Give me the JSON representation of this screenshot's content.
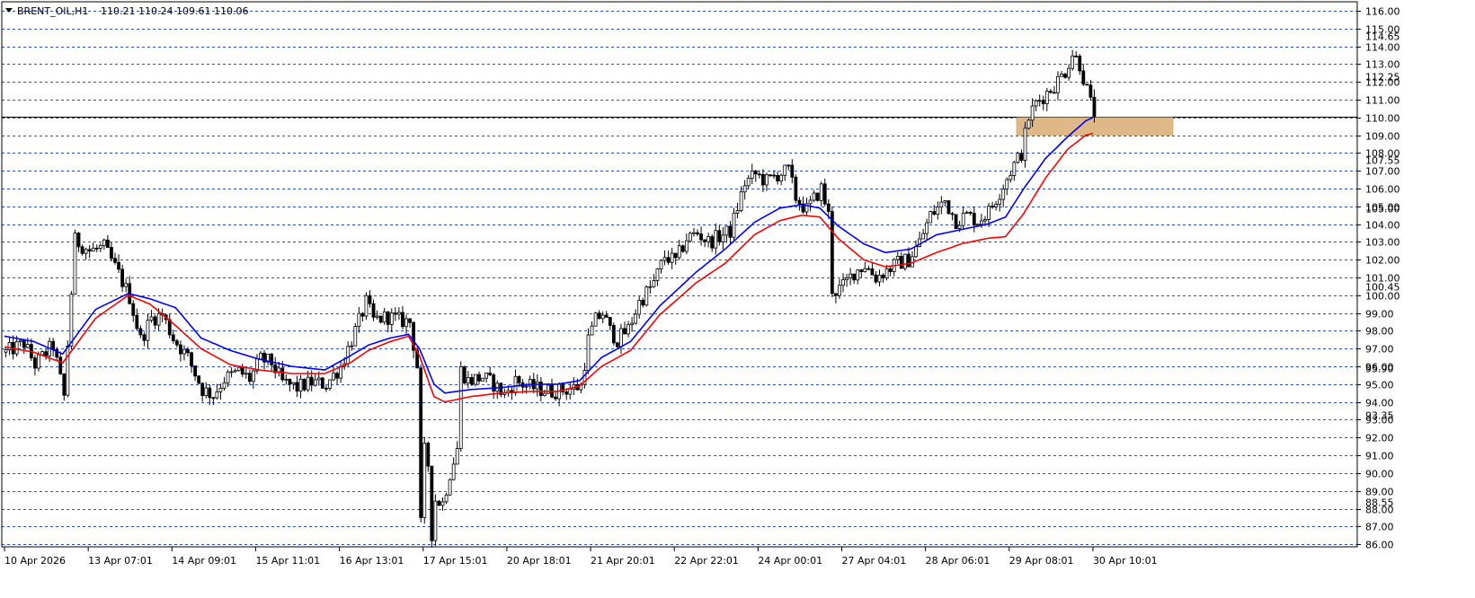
{
  "header": {
    "symbol": "BRENT_OIL,H1",
    "ohlc": "110.21 110.24 109.61 110.06"
  },
  "chart_data": {
    "type": "candlestick",
    "ylim": [
      85.3,
      116.3
    ],
    "y_ticks": [
      {
        "value": 116,
        "label": "116.00"
      },
      {
        "value": 115,
        "label": "115.00"
      },
      {
        "value": 114,
        "label": "114.00"
      },
      {
        "value": 113,
        "label": "113.00"
      },
      {
        "value": 112,
        "label": "112.00"
      },
      {
        "value": 111,
        "label": "111.00"
      },
      {
        "value": 110,
        "label": "110.00"
      },
      {
        "value": 109,
        "label": "109.00"
      },
      {
        "value": 108,
        "label": "108.00"
      },
      {
        "value": 107,
        "label": "107.00"
      },
      {
        "value": 106,
        "label": "106.00"
      },
      {
        "value": 105,
        "label": "105.00"
      },
      {
        "value": 104,
        "label": "104.00"
      },
      {
        "value": 103,
        "label": "103.00"
      },
      {
        "value": 102,
        "label": "102.00"
      },
      {
        "value": 101,
        "label": "101.00"
      },
      {
        "value": 100,
        "label": "100.00"
      },
      {
        "value": 99,
        "label": "99.00"
      },
      {
        "value": 98,
        "label": "98.00"
      },
      {
        "value": 97,
        "label": "97.00"
      },
      {
        "value": 96,
        "label": "96.00"
      },
      {
        "value": 95,
        "label": "95.00"
      },
      {
        "value": 94,
        "label": "94.00"
      },
      {
        "value": 93,
        "label": "93.00"
      },
      {
        "value": 92,
        "label": "92.00"
      },
      {
        "value": 91,
        "label": "91.00"
      },
      {
        "value": 90,
        "label": "90.00"
      },
      {
        "value": 89,
        "label": "89.00"
      },
      {
        "value": 88,
        "label": "88.00"
      },
      {
        "value": 87,
        "label": "87.00"
      },
      {
        "value": 86,
        "label": "86.00"
      }
    ],
    "y_extra_labels": [
      {
        "value": 114.6,
        "label": "114.65"
      },
      {
        "value": 112.3,
        "label": "112.25"
      },
      {
        "value": 107.6,
        "label": "107.55"
      },
      {
        "value": 104.9,
        "label": "105.00"
      },
      {
        "value": 100.5,
        "label": "100.45"
      },
      {
        "value": 95.9,
        "label": "95.90"
      },
      {
        "value": 93.3,
        "label": "93.35"
      },
      {
        "value": 88.4,
        "label": "88.55"
      }
    ],
    "x_labels": [
      {
        "x": 0,
        "label": "10 Apr 2026"
      },
      {
        "x": 23,
        "label": "13 Apr 07:01"
      },
      {
        "x": 46,
        "label": "14 Apr 09:01"
      },
      {
        "x": 69,
        "label": "15 Apr 11:01"
      },
      {
        "x": 92,
        "label": "16 Apr 13:01"
      },
      {
        "x": 115,
        "label": "17 Apr 15:01"
      },
      {
        "x": 138,
        "label": "20 Apr 18:01"
      },
      {
        "x": 161,
        "label": "21 Apr 20:01"
      },
      {
        "x": 184,
        "label": "22 Apr 22:01"
      },
      {
        "x": 207,
        "label": "24 Apr 00:01"
      },
      {
        "x": 230,
        "label": "27 Apr 04:01"
      },
      {
        "x": 253,
        "label": "28 Apr 06:01"
      },
      {
        "x": 276,
        "label": "29 Apr 08:01"
      },
      {
        "x": 299,
        "label": "30 Apr 10:01"
      }
    ],
    "x_range": [
      0,
      302
    ],
    "zone": {
      "x_start": 278,
      "x_end": 321,
      "y_low": 109,
      "y_high": 110,
      "color": "#DEB887"
    },
    "colors": {
      "grid": "#2F4FBF",
      "candle": "#000000",
      "ma_fast": "#0000FF",
      "ma_slow": "#FF0000",
      "current_price_line": "#000000",
      "axis": "#000000"
    },
    "current_price": 110.06,
    "price_path": [
      [
        0,
        96.8
      ],
      [
        5,
        97.3
      ],
      [
        8,
        96.1
      ],
      [
        13,
        97.2
      ],
      [
        16,
        94.3
      ],
      [
        19,
        103.1
      ],
      [
        23,
        102.5
      ],
      [
        27,
        102.7
      ],
      [
        31,
        101.2
      ],
      [
        34,
        99.9
      ],
      [
        37,
        97.5
      ],
      [
        40,
        98.7
      ],
      [
        43,
        98.9
      ],
      [
        46,
        97.6
      ],
      [
        50,
        96.5
      ],
      [
        54,
        94.7
      ],
      [
        57,
        94.4
      ],
      [
        60,
        95.3
      ],
      [
        64,
        95.7
      ],
      [
        67,
        95.3
      ],
      [
        70,
        96.4
      ],
      [
        73,
        96.2
      ],
      [
        76,
        95.1
      ],
      [
        80,
        94.8
      ],
      [
        84,
        95.1
      ],
      [
        88,
        95.0
      ],
      [
        92,
        96.0
      ],
      [
        96,
        98.0
      ],
      [
        99,
        99.6
      ],
      [
        101,
        98.6
      ],
      [
        105,
        98.8
      ],
      [
        108,
        98.6
      ],
      [
        111,
        98.5
      ],
      [
        113,
        96.0
      ],
      [
        114,
        92.0
      ],
      [
        116,
        90.5
      ],
      [
        117,
        87.0
      ],
      [
        118,
        88.5
      ],
      [
        120,
        88.3
      ],
      [
        122,
        90.0
      ],
      [
        124,
        91.4
      ],
      [
        125,
        95.8
      ],
      [
        127,
        95.2
      ],
      [
        131,
        95.4
      ],
      [
        134,
        95.0
      ],
      [
        137,
        94.4
      ],
      [
        140,
        95.2
      ],
      [
        143,
        94.9
      ],
      [
        147,
        94.7
      ],
      [
        150,
        94.6
      ],
      [
        154,
        94.7
      ],
      [
        158,
        94.9
      ],
      [
        160,
        97.5
      ],
      [
        162,
        98.6
      ],
      [
        164,
        99.0
      ],
      [
        166,
        98.0
      ],
      [
        168,
        97.5
      ],
      [
        171,
        98.1
      ],
      [
        174,
        99.6
      ],
      [
        178,
        100.7
      ],
      [
        181,
        102.2
      ],
      [
        184,
        101.9
      ],
      [
        187,
        103.2
      ],
      [
        190,
        103.5
      ],
      [
        193,
        103.0
      ],
      [
        196,
        103.3
      ],
      [
        199,
        103.6
      ],
      [
        203,
        106.3
      ],
      [
        206,
        106.8
      ],
      [
        209,
        106.4
      ],
      [
        212,
        106.8
      ],
      [
        215,
        107.0
      ],
      [
        217,
        105.5
      ],
      [
        220,
        104.8
      ],
      [
        222,
        105.4
      ],
      [
        224,
        106.0
      ],
      [
        226,
        104.5
      ],
      [
        227,
        100.1
      ],
      [
        230,
        100.5
      ],
      [
        233,
        101.3
      ],
      [
        236,
        101.7
      ],
      [
        239,
        101.0
      ],
      [
        242,
        101.4
      ],
      [
        245,
        101.8
      ],
      [
        248,
        102.0
      ],
      [
        251,
        103.0
      ],
      [
        254,
        104.5
      ],
      [
        258,
        105.3
      ],
      [
        261,
        104.2
      ],
      [
        264,
        104.5
      ],
      [
        267,
        104.2
      ],
      [
        270,
        104.7
      ],
      [
        273,
        105.8
      ],
      [
        276,
        107.0
      ],
      [
        279,
        108.0
      ],
      [
        281,
        110.0
      ],
      [
        283,
        110.8
      ],
      [
        285,
        111.2
      ],
      [
        288,
        111.8
      ],
      [
        291,
        112.6
      ],
      [
        293,
        113.6
      ],
      [
        295,
        113.0
      ],
      [
        297,
        111.5
      ],
      [
        299,
        110.06
      ]
    ],
    "ma_slow_path": [
      [
        0,
        97.1
      ],
      [
        8,
        96.8
      ],
      [
        16,
        96.2
      ],
      [
        25,
        98.7
      ],
      [
        34,
        100.0
      ],
      [
        40,
        99.5
      ],
      [
        47,
        98.3
      ],
      [
        54,
        97.0
      ],
      [
        62,
        96.1
      ],
      [
        70,
        95.8
      ],
      [
        79,
        95.6
      ],
      [
        88,
        95.6
      ],
      [
        95,
        96.2
      ],
      [
        100,
        96.9
      ],
      [
        106,
        97.4
      ],
      [
        111,
        97.7
      ],
      [
        114,
        96.6
      ],
      [
        118,
        94.3
      ],
      [
        121,
        94.0
      ],
      [
        128,
        94.3
      ],
      [
        136,
        94.5
      ],
      [
        145,
        94.6
      ],
      [
        152,
        94.6
      ],
      [
        158,
        94.9
      ],
      [
        164,
        96.0
      ],
      [
        172,
        96.9
      ],
      [
        180,
        98.9
      ],
      [
        190,
        100.7
      ],
      [
        198,
        101.8
      ],
      [
        206,
        103.4
      ],
      [
        213,
        104.2
      ],
      [
        219,
        104.5
      ],
      [
        224,
        104.4
      ],
      [
        229,
        103.2
      ],
      [
        236,
        102.0
      ],
      [
        242,
        101.6
      ],
      [
        249,
        101.8
      ],
      [
        256,
        102.4
      ],
      [
        263,
        102.9
      ],
      [
        270,
        103.2
      ],
      [
        275,
        103.3
      ],
      [
        280,
        104.6
      ],
      [
        286,
        106.6
      ],
      [
        292,
        108.2
      ],
      [
        297,
        109.0
      ],
      [
        299,
        109.1
      ]
    ],
    "ma_fast_path": [
      [
        0,
        97.7
      ],
      [
        8,
        97.4
      ],
      [
        16,
        96.7
      ],
      [
        25,
        99.2
      ],
      [
        34,
        100.1
      ],
      [
        40,
        99.8
      ],
      [
        47,
        99.3
      ],
      [
        54,
        97.6
      ],
      [
        62,
        96.9
      ],
      [
        70,
        96.4
      ],
      [
        79,
        96.0
      ],
      [
        88,
        95.8
      ],
      [
        95,
        96.6
      ],
      [
        100,
        97.2
      ],
      [
        106,
        97.6
      ],
      [
        111,
        97.8
      ],
      [
        114,
        97.0
      ],
      [
        118,
        95.0
      ],
      [
        121,
        94.5
      ],
      [
        128,
        94.7
      ],
      [
        136,
        94.8
      ],
      [
        145,
        95.0
      ],
      [
        152,
        95.0
      ],
      [
        158,
        95.2
      ],
      [
        164,
        96.5
      ],
      [
        172,
        97.4
      ],
      [
        180,
        99.4
      ],
      [
        190,
        101.3
      ],
      [
        198,
        102.6
      ],
      [
        206,
        104.1
      ],
      [
        213,
        104.9
      ],
      [
        219,
        105.1
      ],
      [
        224,
        104.9
      ],
      [
        229,
        103.9
      ],
      [
        236,
        102.9
      ],
      [
        242,
        102.4
      ],
      [
        249,
        102.6
      ],
      [
        256,
        103.4
      ],
      [
        263,
        103.7
      ],
      [
        270,
        104.0
      ],
      [
        275,
        104.4
      ],
      [
        280,
        106.0
      ],
      [
        286,
        107.7
      ],
      [
        292,
        108.9
      ],
      [
        297,
        109.8
      ],
      [
        299,
        110.0
      ]
    ]
  }
}
